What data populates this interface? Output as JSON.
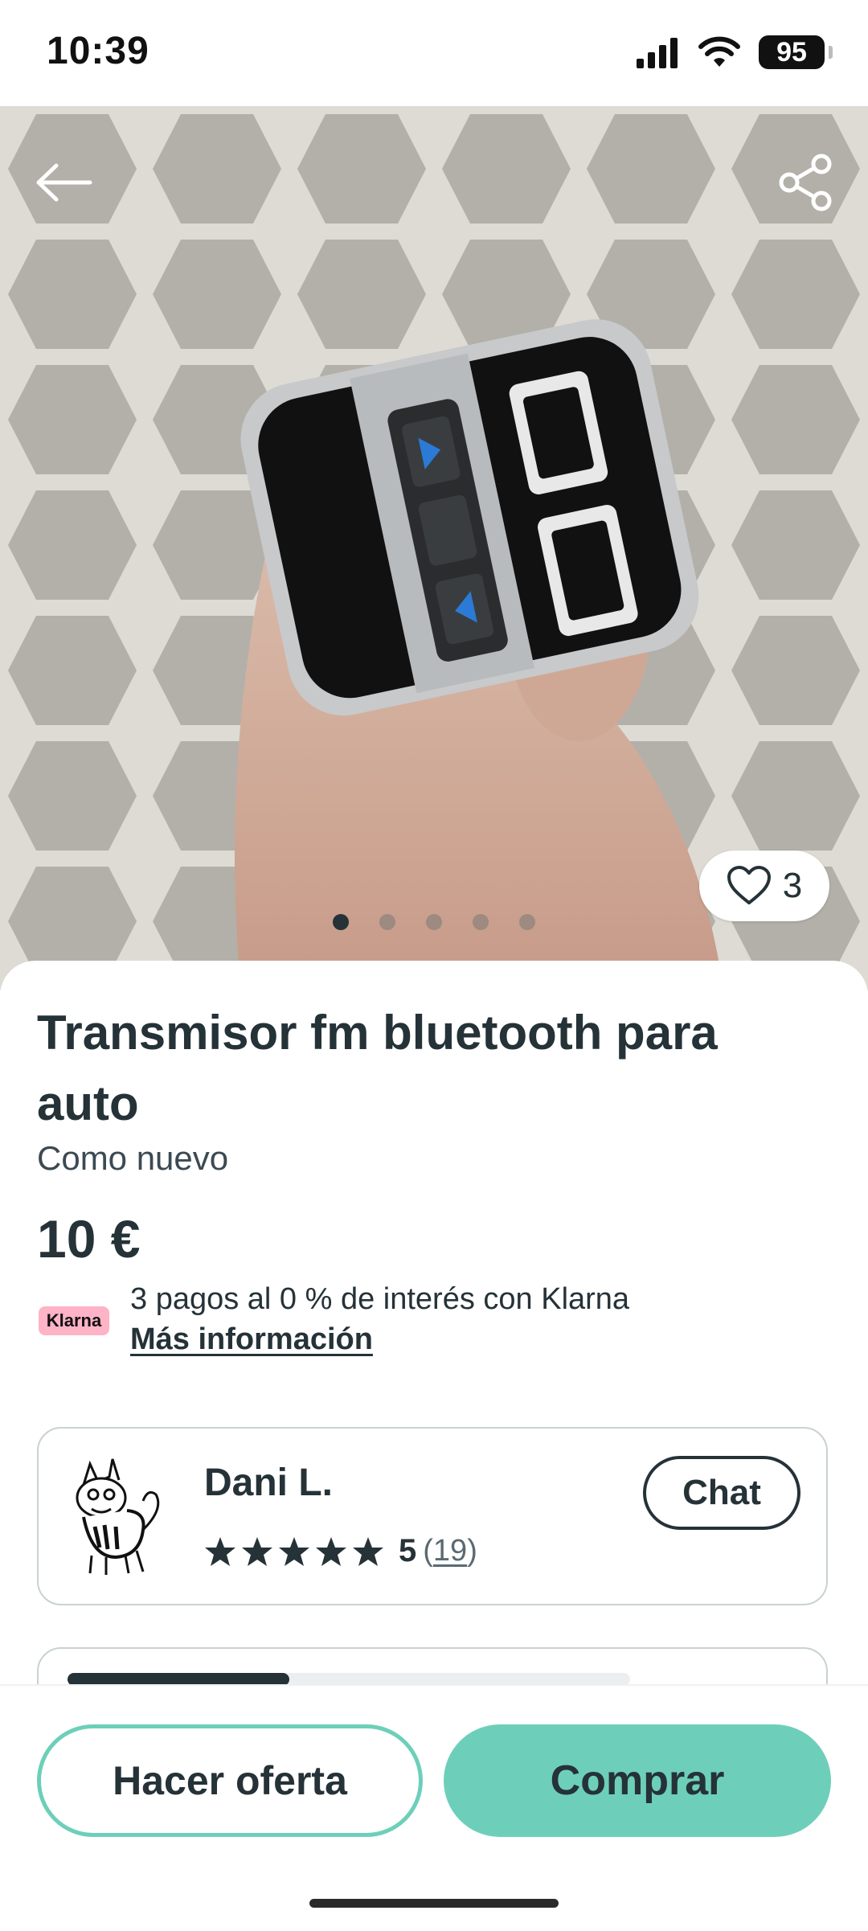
{
  "status_bar": {
    "time": "10:39",
    "battery": "95"
  },
  "product": {
    "title": "Transmisor fm bluetooth para auto",
    "condition": "Como nuevo",
    "price": "10 €",
    "likes": "3",
    "image_count": 5,
    "active_image": 1
  },
  "klarna": {
    "badge": "Klarna",
    "text": "3 pagos al 0 % de interés con Klarna",
    "link": "Más información"
  },
  "seller": {
    "name": "Dani L.",
    "rating": "5",
    "reviews": "19",
    "stars": 5,
    "chat_label": "Chat"
  },
  "actions": {
    "offer_label": "Hacer oferta",
    "buy_label": "Comprar"
  },
  "colors": {
    "accent": "#6dcfba",
    "text": "#253238",
    "klarna_pink": "#ffb3c7"
  },
  "icons": {
    "back": "arrow-left-icon",
    "share": "share-icon",
    "like": "heart-icon",
    "star": "star-icon"
  }
}
